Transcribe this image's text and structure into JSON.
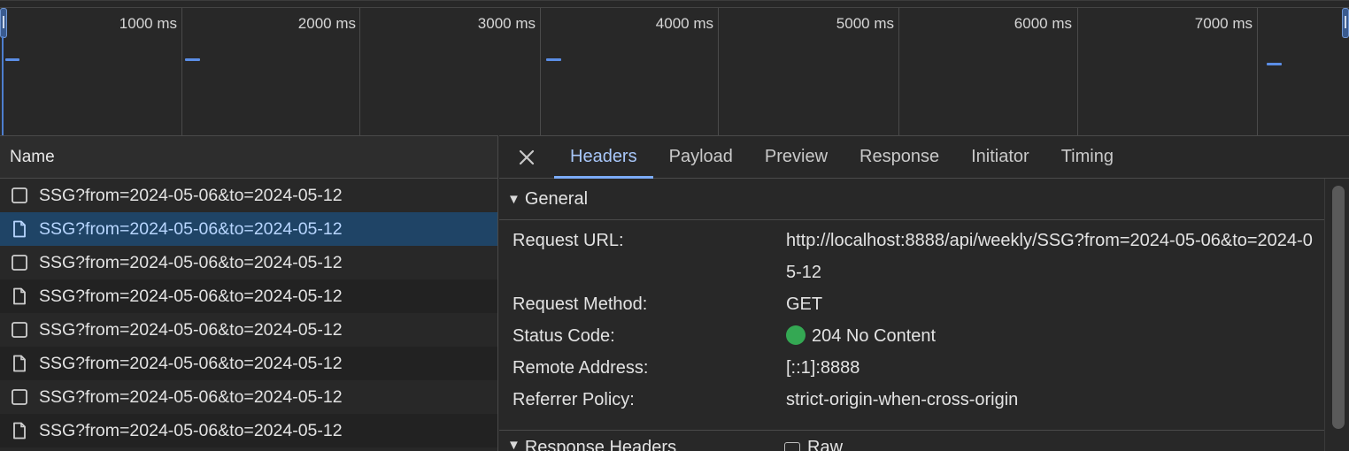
{
  "overview": {
    "ticks": [
      "1000 ms",
      "2000 ms",
      "3000 ms",
      "4000 ms",
      "5000 ms",
      "6000 ms",
      "7000 ms"
    ],
    "bar_color": "#5b8ee6"
  },
  "list": {
    "header": "Name",
    "rows": [
      {
        "name": "SSG?from=2024-05-06&to=2024-05-12",
        "icon": "checkbox-doc-icon"
      },
      {
        "name": "SSG?from=2024-05-06&to=2024-05-12",
        "icon": "file-icon",
        "selected": true
      },
      {
        "name": "SSG?from=2024-05-06&to=2024-05-12",
        "icon": "checkbox-doc-icon"
      },
      {
        "name": "SSG?from=2024-05-06&to=2024-05-12",
        "icon": "file-icon"
      },
      {
        "name": "SSG?from=2024-05-06&to=2024-05-12",
        "icon": "checkbox-doc-icon"
      },
      {
        "name": "SSG?from=2024-05-06&to=2024-05-12",
        "icon": "file-icon"
      },
      {
        "name": "SSG?from=2024-05-06&to=2024-05-12",
        "icon": "checkbox-doc-icon"
      },
      {
        "name": "SSG?from=2024-05-06&to=2024-05-12",
        "icon": "file-icon"
      }
    ]
  },
  "details": {
    "tabs": [
      "Headers",
      "Payload",
      "Preview",
      "Response",
      "Initiator",
      "Timing"
    ],
    "active_tab": "Headers",
    "general": {
      "title": "General",
      "request_url_label": "Request URL:",
      "request_url": "http://localhost:8888/api/weekly/SSG?from=2024-05-06&to=2024-05-12",
      "request_method_label": "Request Method:",
      "request_method": "GET",
      "status_code_label": "Status Code:",
      "status_code": "204 No Content",
      "status_color": "#34a853",
      "remote_address_label": "Remote Address:",
      "remote_address": "[::1]:8888",
      "referrer_policy_label": "Referrer Policy:",
      "referrer_policy": "strict-origin-when-cross-origin"
    },
    "response_headers": {
      "title": "Response Headers",
      "raw_label": "Raw"
    }
  },
  "colors": {
    "accent": "#7cacf8",
    "selected_row": "#1f4466"
  }
}
